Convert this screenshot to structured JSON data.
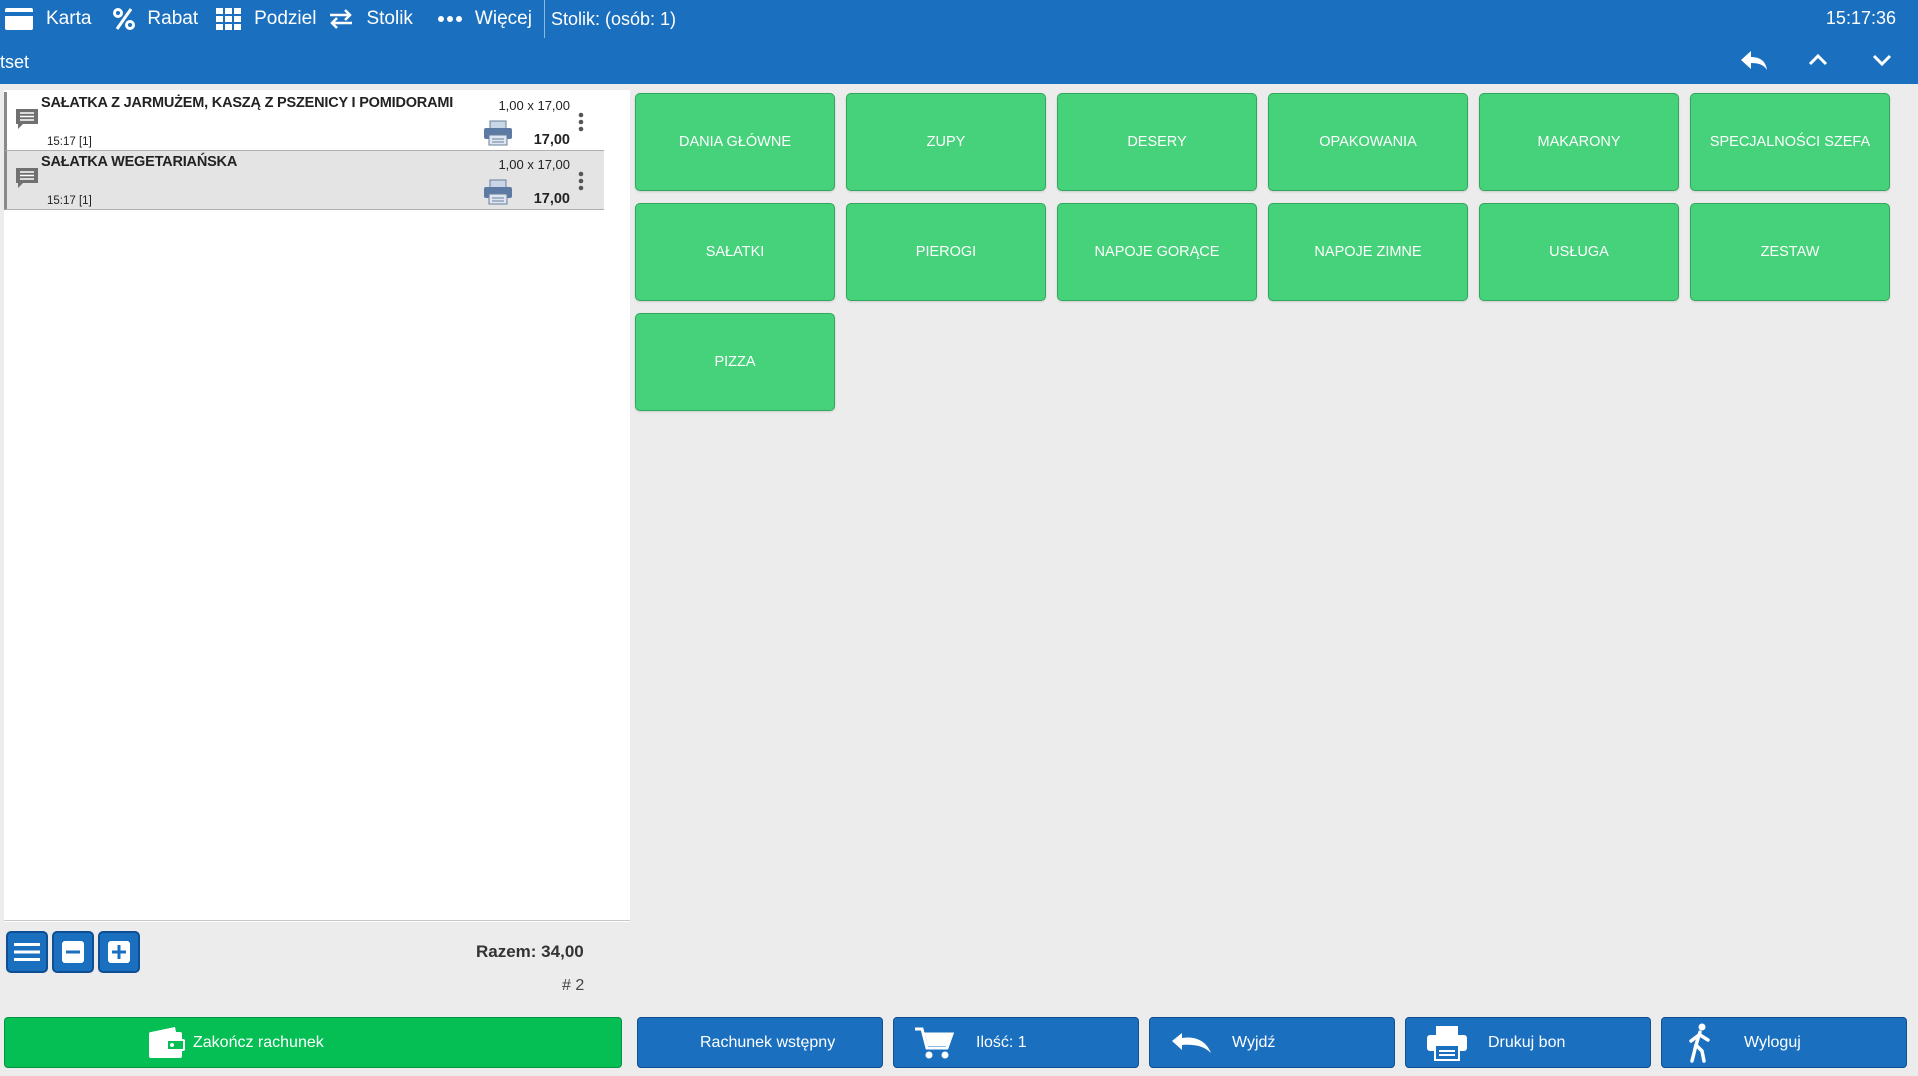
{
  "header": {
    "menu": [
      {
        "label": "Karta",
        "icon": "card-icon"
      },
      {
        "label": "Rabat",
        "icon": "percent-icon"
      },
      {
        "label": "Podziel",
        "icon": "grid-icon"
      },
      {
        "label": "Stolik",
        "icon": "swap-icon"
      },
      {
        "label": "Więcej",
        "icon": "more-dots-icon"
      }
    ],
    "stolik_info": "Stolik: (osób: 1)",
    "clock": "15:17:36",
    "subtitle": "tset"
  },
  "order": {
    "items": [
      {
        "name": "SAŁATKA Z JARMUŻEM, KASZĄ Z PSZENICY I POMIDORAMI",
        "qty_price": "1,00 x 17,00",
        "time": "15:17  [1]",
        "total": "17,00"
      },
      {
        "name": "SAŁATKA WEGETARIAŃSKA",
        "qty_price": "1,00 x 17,00",
        "time": "15:17  [1]",
        "total": "17,00"
      }
    ],
    "total_label": "Razem: 34,00",
    "order_number": "# 2"
  },
  "categories": [
    "DANIA GŁÓWNE",
    "ZUPY",
    "DESERY",
    "OPAKOWANIA",
    "MAKARONY",
    "SPECJALNOŚCI SZEFA",
    "SAŁATKI",
    "PIEROGI",
    "NAPOJE GORĄCE",
    "NAPOJE ZIMNE",
    "USŁUGA",
    "ZESTAW",
    "PIZZA"
  ],
  "actions": {
    "finish": "Zakończ rachunek",
    "preliminary": "Rachunek wstępny",
    "quantity": "Ilość: 1",
    "exit": "Wyjdź",
    "print": "Drukuj bon",
    "logout": "Wyloguj"
  },
  "colors": {
    "header": "#1a6fbf",
    "category": "#45d27a",
    "finish": "#05bf55"
  }
}
